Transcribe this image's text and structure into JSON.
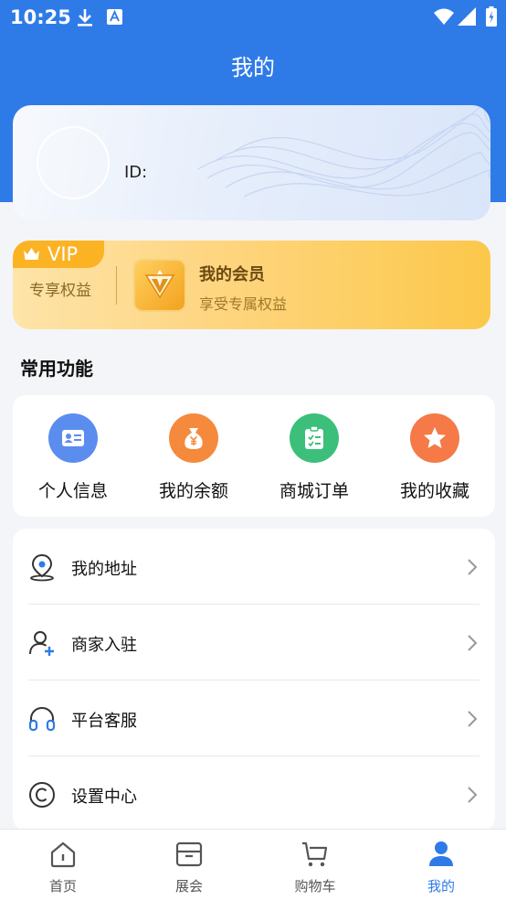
{
  "status_bar": {
    "time": "10:25"
  },
  "header": {
    "title": "我的"
  },
  "profile": {
    "id_label": "ID:"
  },
  "vip": {
    "badge": "VIP",
    "privilege_label": "专享权益",
    "title": "我的会员",
    "subtitle": "享受专属权益"
  },
  "functions": {
    "section_title": "常用功能",
    "items": [
      {
        "label": "个人信息",
        "icon": "id-card-icon",
        "color": "#5b8def"
      },
      {
        "label": "我的余额",
        "icon": "money-bag-icon",
        "color": "#f58a3c"
      },
      {
        "label": "商城订单",
        "icon": "clipboard-icon",
        "color": "#3cbf7a"
      },
      {
        "label": "我的收藏",
        "icon": "star-icon",
        "color": "#f57a48"
      }
    ]
  },
  "menu": {
    "items": [
      {
        "label": "我的地址",
        "icon": "location-pin-icon"
      },
      {
        "label": "商家入驻",
        "icon": "user-add-icon"
      },
      {
        "label": "平台客服",
        "icon": "headphones-icon"
      },
      {
        "label": "设置中心",
        "icon": "settings-c-icon"
      }
    ]
  },
  "tabbar": {
    "items": [
      {
        "label": "首页",
        "icon": "home-icon",
        "active": false
      },
      {
        "label": "展会",
        "icon": "exhibition-box-icon",
        "active": false
      },
      {
        "label": "购物车",
        "icon": "cart-icon",
        "active": false
      },
      {
        "label": "我的",
        "icon": "user-icon",
        "active": true
      }
    ]
  },
  "colors": {
    "primary": "#2e7be8",
    "background": "#f4f5f9",
    "vip_gold": "#fbb324"
  }
}
